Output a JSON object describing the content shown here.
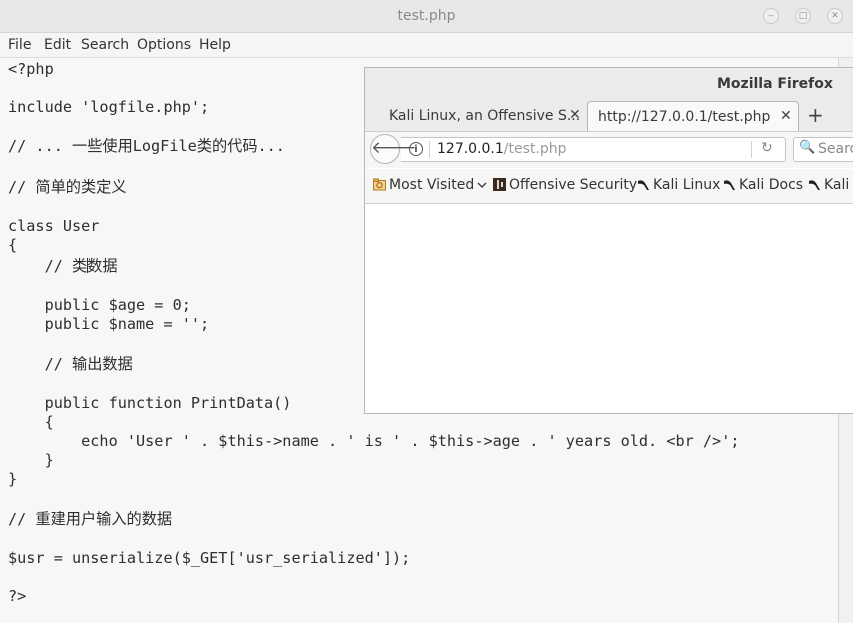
{
  "editor": {
    "title": "test.php",
    "controls": {
      "minimize": "‒",
      "maximize": "□",
      "close": "✕"
    },
    "menu": [
      "File",
      "Edit",
      "Search",
      "Options",
      "Help"
    ],
    "code_lines": [
      "<?php",
      "include 'logfile.php';",
      "// ... 一些使用LogFile类的代码...",
      "// 简单的类定义",
      "class User",
      "{",
      "    // 类",
      "数据",
      "    public $age = 0;",
      "    public $name = '';",
      "    // 输出数据",
      "    public function PrintData()",
      "    {",
      "        echo 'User ' . $this->name . ' is ' . $this->age . ' years old. <br />';",
      "    }",
      "}",
      "// 重建用户输入的数据",
      "$usr = unserialize($_GET['usr_serialized']);",
      "?>"
    ]
  },
  "firefox": {
    "window_title": "Mozilla Firefox",
    "tabs": [
      {
        "label": "Kali Linux, an Offensive S...",
        "close": "✕",
        "active": false
      },
      {
        "label": "http://127.0.0.1/test.php",
        "close": "✕",
        "active": true
      }
    ],
    "new_tab": "+",
    "back_glyph": "🡐",
    "info_glyph": "i",
    "url_host": "127.0.0.1",
    "url_path": "/test.php",
    "reload_glyph": "↻",
    "search_glyph": "🔍",
    "search_placeholder": "Search",
    "bookmarks": [
      "Most Visited",
      "Offensive Security",
      "Kali Linux",
      "Kali Docs",
      "Kali"
    ]
  },
  "icons": {
    "most_visited": "folder-icon",
    "offensive_security": "offsec-icon",
    "kali": "kali-dragon-icon"
  },
  "colors": {
    "editor_bg": "#f7f7f7",
    "code_text": "#2e2e2e",
    "terminal_strip": "#1b8ba8"
  }
}
